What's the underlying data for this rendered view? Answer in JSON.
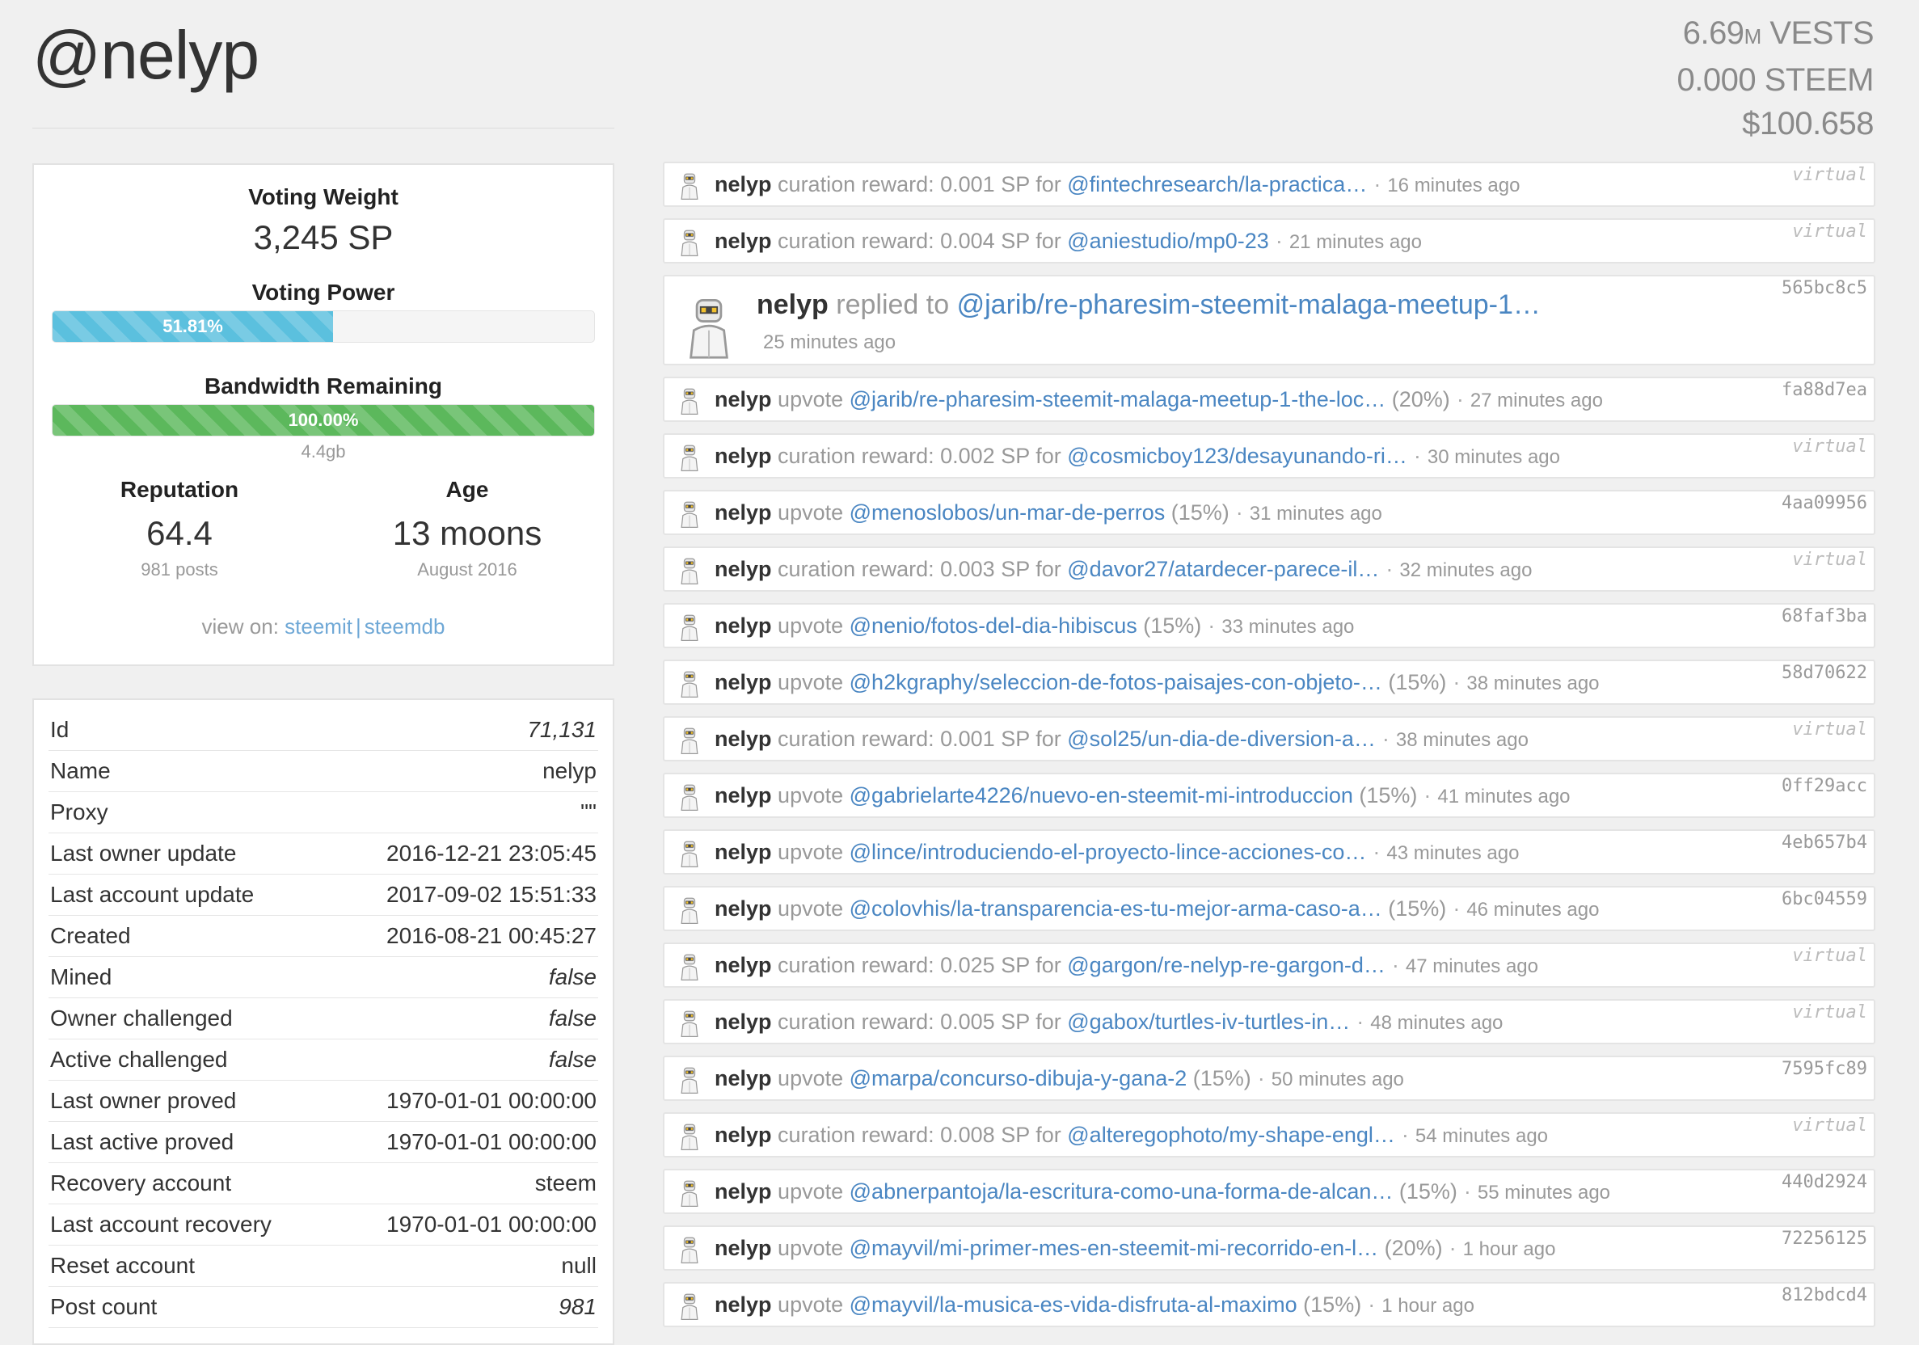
{
  "page": {
    "title": "@nelyp",
    "stats": {
      "vests_num": "6.69",
      "vests_unit": "M",
      "vests_label": " VESTS",
      "steem": "0.000 STEEM",
      "usd": "$100.658"
    }
  },
  "summary": {
    "voting_weight_label": "Voting Weight",
    "voting_weight_value": "3,245 SP",
    "voting_power_label": "Voting Power",
    "voting_power_text": "51.81%",
    "voting_power_pct": 51.81,
    "bandwidth_label": "Bandwidth Remaining",
    "bandwidth_text": "100.00%",
    "bandwidth_pct": 100,
    "bandwidth_size": "4.4gb",
    "reputation_label": "Reputation",
    "reputation_value": "64.4",
    "posts": "981 posts",
    "age_label": "Age",
    "age_value": "13 moons",
    "age_since": "August 2016",
    "view_on_label": "view on:",
    "link_steemit": "steemit",
    "link_sep": "|",
    "link_steemdb": "steemdb"
  },
  "properties": [
    {
      "label": "Id",
      "value": "71,131",
      "italic": true
    },
    {
      "label": "Name",
      "value": "nelyp",
      "italic": false
    },
    {
      "label": "Proxy",
      "value": "\"\"",
      "italic": false
    },
    {
      "label": "Last owner update",
      "value": "2016-12-21 23:05:45",
      "italic": false
    },
    {
      "label": "Last account update",
      "value": "2017-09-02 15:51:33",
      "italic": false
    },
    {
      "label": "Created",
      "value": "2016-08-21 00:45:27",
      "italic": false
    },
    {
      "label": "Mined",
      "value": "false",
      "italic": true
    },
    {
      "label": "Owner challenged",
      "value": "false",
      "italic": true
    },
    {
      "label": "Active challenged",
      "value": "false",
      "italic": true
    },
    {
      "label": "Last owner proved",
      "value": "1970-01-01 00:00:00",
      "italic": false
    },
    {
      "label": "Last active proved",
      "value": "1970-01-01 00:00:00",
      "italic": false
    },
    {
      "label": "Recovery account",
      "value": "steem",
      "italic": false
    },
    {
      "label": "Last account recovery",
      "value": "1970-01-01 00:00:00",
      "italic": false
    },
    {
      "label": "Reset account",
      "value": "null",
      "italic": false
    },
    {
      "label": "Post count",
      "value": "981",
      "italic": true
    }
  ],
  "feed": [
    {
      "user": "nelyp",
      "verb": "curation reward: 0.001 SP for",
      "link": "@fintechresearch/la-practica…",
      "suffix": "",
      "time": "16 minutes ago",
      "tag": "virtual",
      "virtual": true
    },
    {
      "user": "nelyp",
      "verb": "curation reward: 0.004 SP for",
      "link": "@aniestudio/mp0-23",
      "suffix": "",
      "time": "21 minutes ago",
      "tag": "virtual",
      "virtual": true
    },
    {
      "user": "nelyp",
      "verb": "replied to",
      "link": "@jarib/re-pharesim-steemit-malaga-meetup-1…",
      "suffix": "",
      "time": "25 minutes ago",
      "tag": "565bc8c5",
      "virtual": false,
      "big": true
    },
    {
      "user": "nelyp",
      "verb": "upvote",
      "link": "@jarib/re-pharesim-steemit-malaga-meetup-1-the-loc…",
      "suffix": "(20%)",
      "time": "27 minutes ago",
      "tag": "fa88d7ea",
      "virtual": false
    },
    {
      "user": "nelyp",
      "verb": "curation reward: 0.002 SP for",
      "link": "@cosmicboy123/desayunando-ri…",
      "suffix": "",
      "time": "30 minutes ago",
      "tag": "virtual",
      "virtual": true
    },
    {
      "user": "nelyp",
      "verb": "upvote",
      "link": "@menoslobos/un-mar-de-perros",
      "suffix": "(15%)",
      "time": "31 minutes ago",
      "tag": "4aa09956",
      "virtual": false
    },
    {
      "user": "nelyp",
      "verb": "curation reward: 0.003 SP for",
      "link": "@davor27/atardecer-parece-il…",
      "suffix": "",
      "time": "32 minutes ago",
      "tag": "virtual",
      "virtual": true
    },
    {
      "user": "nelyp",
      "verb": "upvote",
      "link": "@nenio/fotos-del-dia-hibiscus",
      "suffix": "(15%)",
      "time": "33 minutes ago",
      "tag": "68faf3ba",
      "virtual": false
    },
    {
      "user": "nelyp",
      "verb": "upvote",
      "link": "@h2kgraphy/seleccion-de-fotos-paisajes-con-objeto-…",
      "suffix": "(15%)",
      "time": "38 minutes ago",
      "tag": "58d70622",
      "virtual": false
    },
    {
      "user": "nelyp",
      "verb": "curation reward: 0.001 SP for",
      "link": "@sol25/un-dia-de-diversion-a…",
      "suffix": "",
      "time": "38 minutes ago",
      "tag": "virtual",
      "virtual": true
    },
    {
      "user": "nelyp",
      "verb": "upvote",
      "link": "@gabrielarte4226/nuevo-en-steemit-mi-introduccion",
      "suffix": "(15%)",
      "time": "41 minutes ago",
      "tag": "0ff29acc",
      "virtual": false
    },
    {
      "user": "nelyp",
      "verb": "upvote",
      "link": "@lince/introduciendo-el-proyecto-lince-acciones-co…",
      "suffix": "",
      "time": "43 minutes ago",
      "tag": "4eb657b4",
      "virtual": false
    },
    {
      "user": "nelyp",
      "verb": "upvote",
      "link": "@colovhis/la-transparencia-es-tu-mejor-arma-caso-a…",
      "suffix": "(15%)",
      "time": "46 minutes ago",
      "tag": "6bc04559",
      "virtual": false
    },
    {
      "user": "nelyp",
      "verb": "curation reward: 0.025 SP for",
      "link": "@gargon/re-nelyp-re-gargon-d…",
      "suffix": "",
      "time": "47 minutes ago",
      "tag": "virtual",
      "virtual": true
    },
    {
      "user": "nelyp",
      "verb": "curation reward: 0.005 SP for",
      "link": "@gabox/turtles-iv-turtles-in…",
      "suffix": "",
      "time": "48 minutes ago",
      "tag": "virtual",
      "virtual": true
    },
    {
      "user": "nelyp",
      "verb": "upvote",
      "link": "@marpa/concurso-dibuja-y-gana-2",
      "suffix": "(15%)",
      "time": "50 minutes ago",
      "tag": "7595fc89",
      "virtual": false
    },
    {
      "user": "nelyp",
      "verb": "curation reward: 0.008 SP for",
      "link": "@alteregophoto/my-shape-engl…",
      "suffix": "",
      "time": "54 minutes ago",
      "tag": "virtual",
      "virtual": true
    },
    {
      "user": "nelyp",
      "verb": "upvote",
      "link": "@abnerpantoja/la-escritura-como-una-forma-de-alcan…",
      "suffix": "(15%)",
      "time": "55 minutes ago",
      "tag": "440d2924",
      "virtual": false
    },
    {
      "user": "nelyp",
      "verb": "upvote",
      "link": "@mayvil/mi-primer-mes-en-steemit-mi-recorrido-en-l…",
      "suffix": "(20%)",
      "time": "1 hour ago",
      "tag": "72256125",
      "virtual": false
    },
    {
      "user": "nelyp",
      "verb": "upvote",
      "link": "@mayvil/la-musica-es-vida-disfruta-al-maximo",
      "suffix": "(15%)",
      "time": "1 hour ago",
      "tag": "812bdcd4",
      "virtual": false
    }
  ]
}
